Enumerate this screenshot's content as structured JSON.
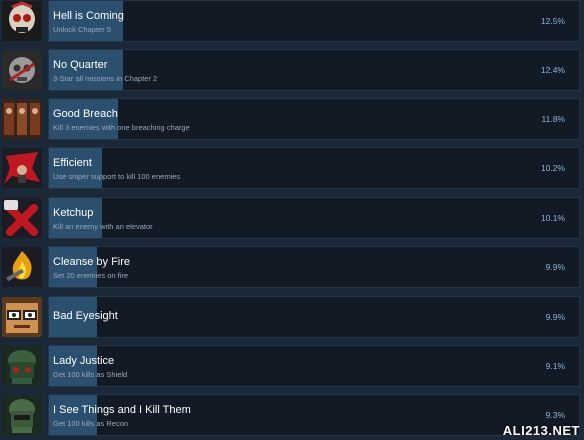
{
  "achievements": [
    {
      "title": "Hell is Coming",
      "desc": "Unlock Chapter 5",
      "percent": "12.5%",
      "fill": 0.125,
      "icon": "skull-icon"
    },
    {
      "title": "No Quarter",
      "desc": "3-Star all missions in Chapter 2",
      "percent": "12.4%",
      "fill": 0.124,
      "icon": "grey-skull-icon"
    },
    {
      "title": "Good Breach",
      "desc": "Kill 3 enemies with one breaching charge",
      "percent": "11.8%",
      "fill": 0.118,
      "icon": "door-breach-icon"
    },
    {
      "title": "Efficient",
      "desc": "Use sniper support to kill 100 enemies",
      "percent": "10.2%",
      "fill": 0.102,
      "icon": "sniper-icon"
    },
    {
      "title": "Ketchup",
      "desc": "Kill an enemy with an elevator",
      "percent": "10.1%",
      "fill": 0.101,
      "icon": "ketchup-icon"
    },
    {
      "title": "Cleanse by Fire",
      "desc": "Set 20 enemies on fire",
      "percent": "9.9%",
      "fill": 0.099,
      "icon": "fire-icon"
    },
    {
      "title": "Bad Eyesight",
      "desc": "",
      "percent": "9.9%",
      "fill": 0.099,
      "icon": "glasses-face-icon"
    },
    {
      "title": "Lady Justice",
      "desc": "Get 100 kills as Shield",
      "percent": "9.1%",
      "fill": 0.091,
      "icon": "shield-soldier-icon"
    },
    {
      "title": "I See Things and I Kill Them",
      "desc": "Get 100 kills as Recon",
      "percent": "9.3%",
      "fill": 0.093,
      "icon": "recon-soldier-icon"
    }
  ],
  "watermark": "ALI213.NET"
}
